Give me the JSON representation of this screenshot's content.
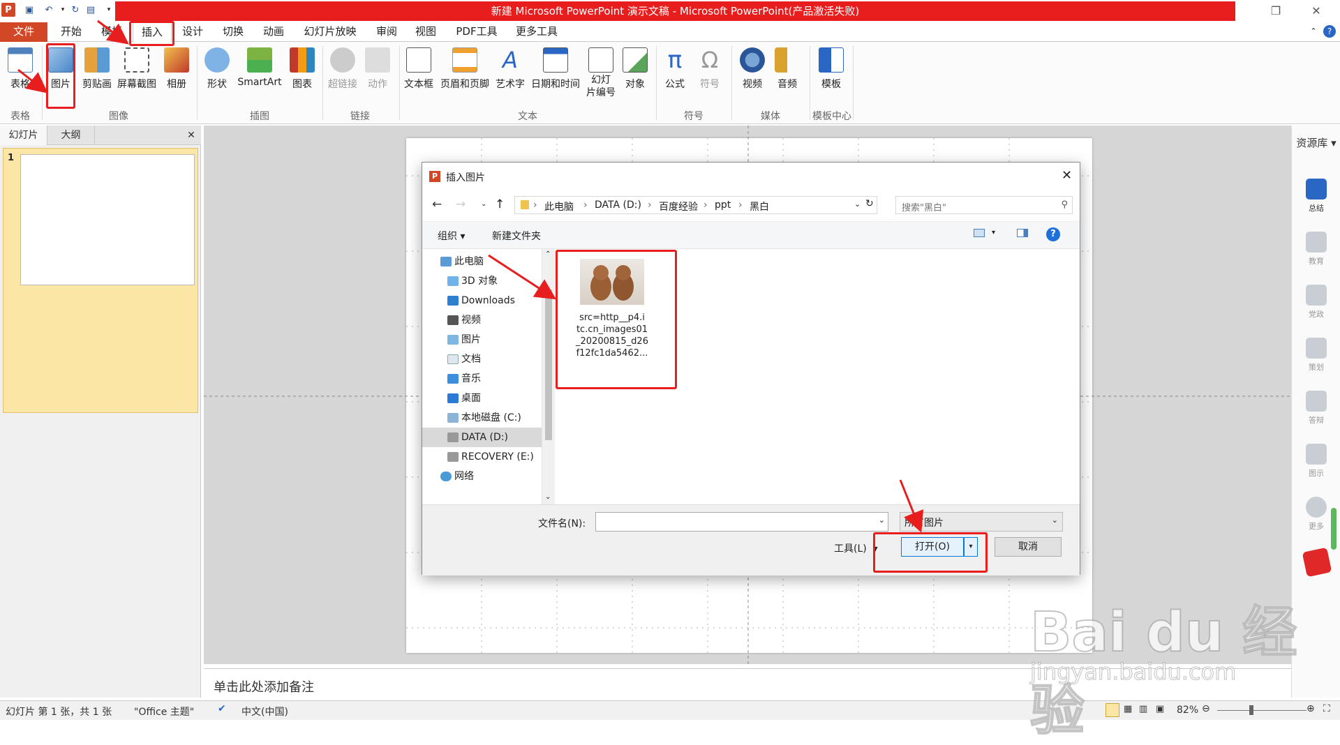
{
  "window": {
    "title": "新建 Microsoft PowerPoint 演示文稿 - Microsoft PowerPoint(产品激活失败)",
    "app_icon": "P"
  },
  "tabs": [
    "文件",
    "开始",
    "模板",
    "插入",
    "设计",
    "切换",
    "动画",
    "幻灯片放映",
    "审阅",
    "视图",
    "PDF工具",
    "更多工具"
  ],
  "ribbon": {
    "buttons": [
      "表格",
      "图片",
      "剪贴画",
      "屏幕截图",
      "相册",
      "形状",
      "SmartArt",
      "图表",
      "超链接",
      "动作",
      "文本框",
      "页眉和页脚",
      "艺术字",
      "日期和时间",
      "幻灯\n片编号",
      "对象",
      "公式",
      "符号",
      "视频",
      "音频",
      "模板"
    ],
    "groups": [
      "表格",
      "图像",
      "插图",
      "链接",
      "文本",
      "符号",
      "媒体",
      "模板中心"
    ]
  },
  "left_pane": {
    "tabs": [
      "幻灯片",
      "大纲"
    ],
    "close": "✕",
    "slide_number": "1"
  },
  "notes_placeholder": "单击此处添加备注",
  "right_panel": {
    "header": "资源库",
    "items": [
      "总结",
      "教育",
      "党政",
      "策划",
      "答辩",
      "图示",
      "更多"
    ]
  },
  "status": {
    "slide_info": "幻灯片 第 1 张，共 1 张",
    "theme": "\"Office 主题\"",
    "language": "中文(中国)",
    "zoom": "82%"
  },
  "dialog": {
    "title": "插入图片",
    "breadcrumb": [
      "此电脑",
      "DATA (D:)",
      "百度经验",
      "ppt",
      "黑白"
    ],
    "search_placeholder": "搜索\"黑白\"",
    "organize": "组织",
    "new_folder": "新建文件夹",
    "tree": [
      "此电脑",
      "3D 对象",
      "Downloads",
      "视频",
      "图片",
      "文档",
      "音乐",
      "桌面",
      "本地磁盘 (C:)",
      "DATA (D:)",
      "RECOVERY (E:)",
      "网络"
    ],
    "file": {
      "name_lines": [
        "src=http__p4.i",
        "tc.cn_images01",
        "_20200815_d26",
        "f12fc1da5462..."
      ]
    },
    "filename_label": "文件名(N):",
    "filename_value": "",
    "filter": "所有图片",
    "tools": "工具(L)",
    "open": "打开(O)",
    "cancel": "取消"
  },
  "watermark": {
    "logo": "Bai du 经验",
    "url": "jingyan.baidu.com"
  },
  "colors": {
    "accent": "#e81d1d",
    "file_tab": "#d24726",
    "selection": "#fbe6a6"
  }
}
